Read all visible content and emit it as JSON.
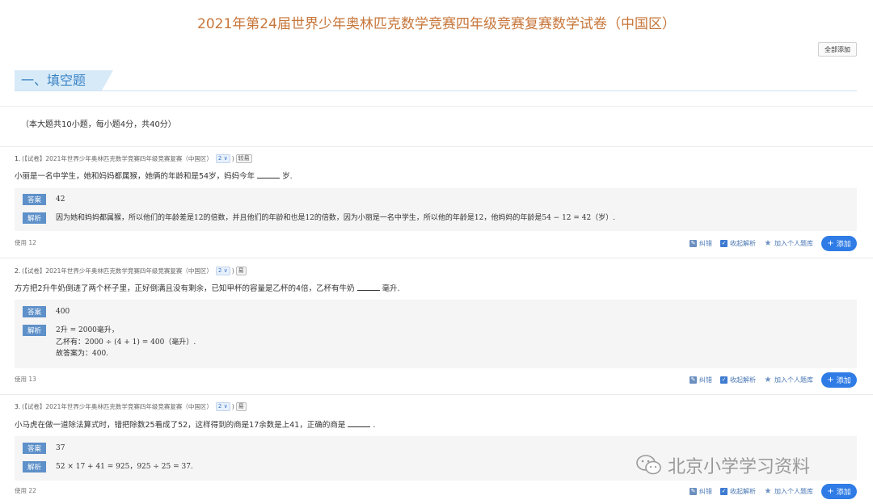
{
  "page": {
    "title": "2021年第24届世界少年奥林匹克数学竞赛四年级竞赛复赛数学试卷（中国区）",
    "add_all_label": "全部添加"
  },
  "section": {
    "title": "一、填空题",
    "note": "（本大题共10小题，每小题4分，共40分）"
  },
  "labels": {
    "answer": "答案",
    "analysis": "解析",
    "report_error": "纠错",
    "fold_analysis": "收起解析",
    "add_to_bank": "加入个人题库",
    "add": "添加"
  },
  "questions": [
    {
      "number": "1.",
      "source": "(【试卷】2021年世界少年奥林匹克数学竞赛四年级竞赛复赛（中国区）",
      "level": "2 ∨",
      "paren": ")",
      "difficulty": "较易",
      "text_before": "小丽是一名中学生，她和妈妈都属猴，她俩的年龄和是54岁，妈妈今年",
      "text_after": "岁.",
      "answer": "42",
      "analysis": [
        "因为她和妈妈都属猴，所以他们的年龄差是12的倍数，并且他们的年龄和也是12的倍数，因为小丽是一名中学生，所以他的年龄是12，他妈妈的年龄是54 − 12 = 42（岁）."
      ],
      "usage": "使用 12"
    },
    {
      "number": "2.",
      "source": "(【试卷】2021年世界少年奥林匹克数学竞赛四年级竞赛复赛（中国区）",
      "level": "2 ∨",
      "paren": ")",
      "difficulty": "易",
      "text_before": "方方把2升牛奶倒进了两个杯子里，正好倒满且没有剩余，已知甲杯的容量是乙杯的4倍，乙杯有牛奶",
      "text_after": "毫升.",
      "answer": "400",
      "analysis": [
        "2升 = 2000毫升，",
        "乙杯有：2000 ÷ (4 + 1) = 400（毫升）.",
        "故答案为：400."
      ],
      "usage": "使用 13"
    },
    {
      "number": "3.",
      "source": "(【试卷】2021年世界少年奥林匹克数学竞赛四年级竞赛复赛（中国区）",
      "level": "2 ∨",
      "paren": ")",
      "difficulty": "易",
      "text_before": "小马虎在做一道除法算式时，错把除数25看成了52，这样得到的商是17余数是上41，正确的商是",
      "text_after": ".",
      "answer": "37",
      "analysis": [
        "52 × 17 + 41 = 925，925 ÷ 25 = 37."
      ],
      "usage": "使用 22"
    }
  ],
  "watermark": {
    "text": "北京小学学习资料",
    "icon": "wechat-icon"
  },
  "colors": {
    "title": "#c7763a",
    "accent": "#2f7ce6",
    "tag": "#5e90c9",
    "section_tab": "#d7eaf8"
  }
}
